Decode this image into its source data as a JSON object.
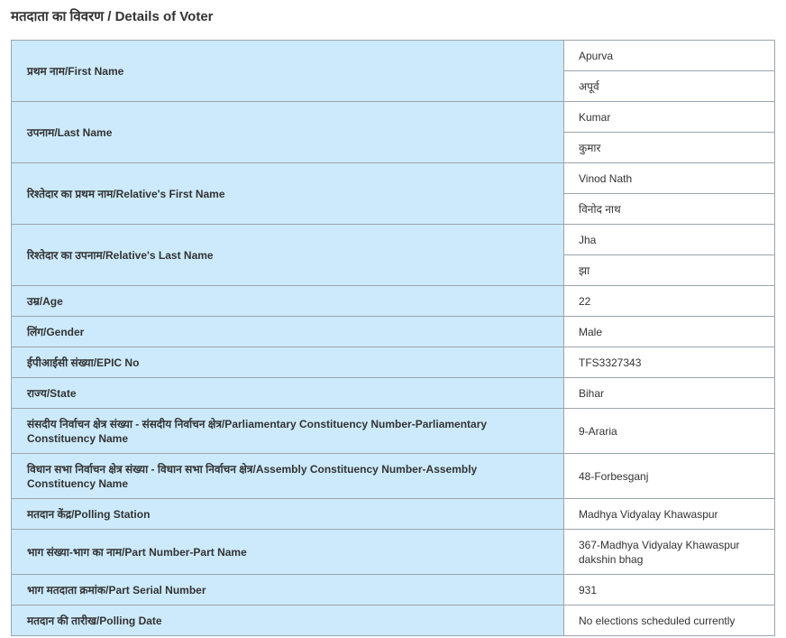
{
  "title": "मतदाता का विवरण / Details of Voter",
  "colors": {
    "label_bg": "#cceafb",
    "border": "#9aa5ad"
  },
  "rows": [
    {
      "label": "प्रथम नाम/First Name",
      "values": [
        "Apurva",
        "अपूर्व"
      ]
    },
    {
      "label": "उपनाम/Last Name",
      "values": [
        "Kumar",
        "कुमार"
      ]
    },
    {
      "label": "रिश्तेदार का प्रथम नाम/Relative's First Name",
      "values": [
        "Vinod Nath",
        "विनोद नाथ"
      ]
    },
    {
      "label": "रिश्तेदार का उपनाम/Relative's Last Name",
      "values": [
        "Jha",
        "झा"
      ]
    },
    {
      "label": "उम्र/Age",
      "value": "22"
    },
    {
      "label": "लिंग/Gender",
      "value": "Male"
    },
    {
      "label": "ईपीआईसी संख्या/EPIC No",
      "value": "TFS3327343"
    },
    {
      "label": "राज्य/State",
      "value": "Bihar"
    },
    {
      "label": "संसदीय निर्वाचन क्षेत्र संख्या - संसदीय निर्वाचन क्षेत्र/Parliamentary Constituency Number-Parliamentary Constituency Name",
      "value": "9-Araria"
    },
    {
      "label": "विधान सभा निर्वाचन क्षेत्र संख्या - विधान सभा निर्वाचन क्षेत्र/Assembly Constituency Number-Assembly Constituency Name",
      "value": "48-Forbesganj"
    },
    {
      "label": "मतदान केंद्र/Polling Station",
      "value": "Madhya Vidyalay Khawaspur"
    },
    {
      "label": "भाग संख्या-भाग का नाम/Part Number-Part Name",
      "value": "367-Madhya Vidyalay Khawaspur dakshin bhag"
    },
    {
      "label": "भाग मतदाता क्रमांक/Part Serial Number",
      "value": "931"
    },
    {
      "label": "मतदान की तारीख/Polling Date",
      "value": "No elections scheduled currently"
    }
  ]
}
